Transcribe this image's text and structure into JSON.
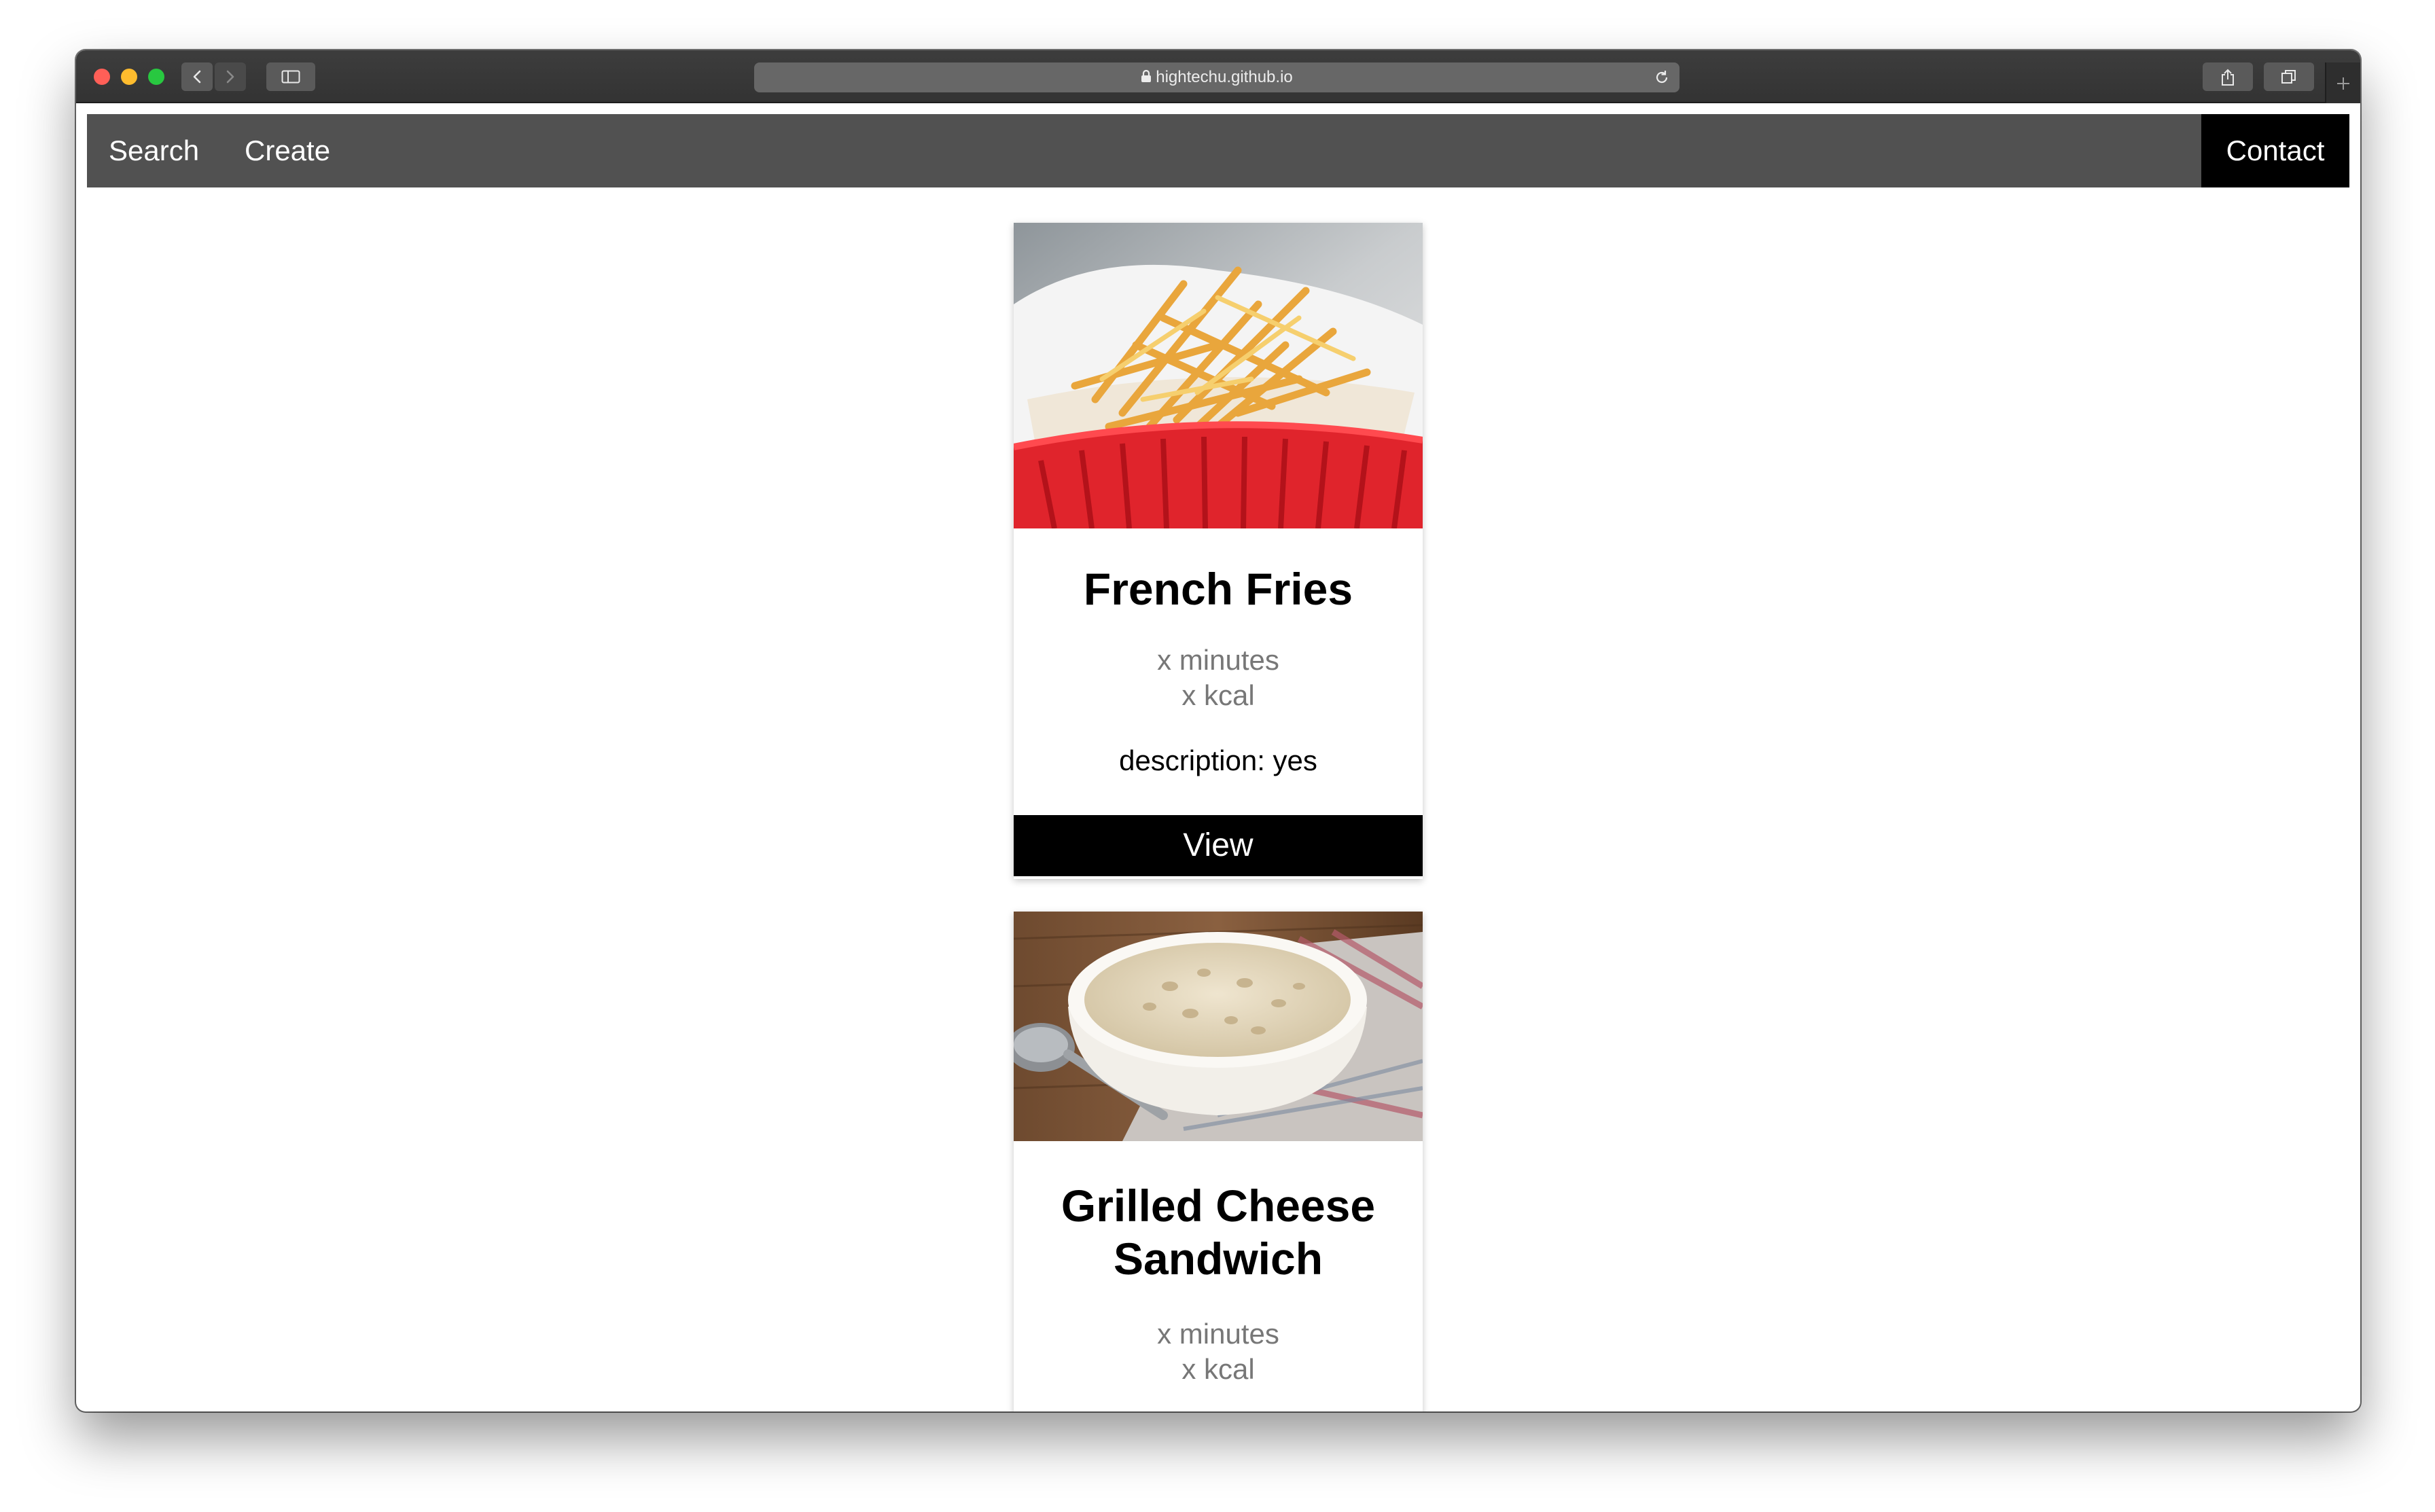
{
  "browser": {
    "url": "hightechu.github.io"
  },
  "navbar": {
    "search": "Search",
    "create": "Create",
    "contact": "Contact"
  },
  "recipes": [
    {
      "title": "French Fries",
      "minutes": "x minutes",
      "kcal": "x kcal",
      "description": "description: yes",
      "button": "View",
      "image": "french-fries-photo"
    },
    {
      "title": "Grilled Cheese Sandwich",
      "minutes": "x minutes",
      "kcal": "x kcal",
      "image": "oatmeal-bowl-photo"
    }
  ],
  "colors": {
    "navbar_bg": "#515151",
    "contact_bg": "#000000",
    "button_bg": "#000000",
    "meta_text": "#777777"
  }
}
